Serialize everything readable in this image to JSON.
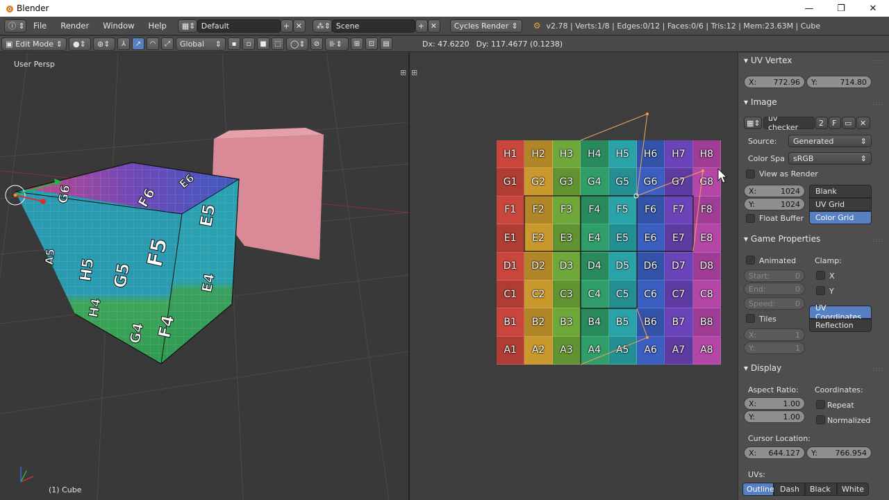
{
  "titlebar": {
    "title": "Blender",
    "minimize": "—",
    "maximize": "❐",
    "close": "✕"
  },
  "info": {
    "menus": [
      "File",
      "Render",
      "Window",
      "Help"
    ],
    "layout": "Default",
    "scene": "Scene",
    "engine": "Cycles Render",
    "stats": "v2.78 | Verts:1/8 | Edges:0/12 | Faces:0/6 | Tris:12 | Mem:23.63M | Cube"
  },
  "toolbar3d": {
    "mode": "Edit Mode",
    "orientation": "Global"
  },
  "uv_header": {
    "dx": "Dx: 47.6220",
    "dy": "Dy: 117.4677 (0.1238)"
  },
  "viewport": {
    "persp_label": "User Persp",
    "object_label": "(1) Cube"
  },
  "uv_grid": {
    "rows": [
      "H",
      "G",
      "F",
      "E",
      "D",
      "C",
      "B",
      "A"
    ],
    "cols": [
      "1",
      "2",
      "3",
      "4",
      "5",
      "6",
      "7",
      "8"
    ],
    "colors": [
      "#c8463c",
      "#c9992e",
      "#6fa83a",
      "#2f9e6a",
      "#2aa3a8",
      "#3b5fc0",
      "#6a44b8",
      "#b446a8"
    ]
  },
  "npanel": {
    "uv_vertex": {
      "title": "UV Vertex",
      "x_label": "X:",
      "x": "772.96",
      "y_label": "Y:",
      "y": "714.80"
    },
    "image": {
      "title": "Image",
      "name": "uv checker",
      "users": "2",
      "fake": "F",
      "source_label": "Source:",
      "source": "Generated",
      "colorspace_label": "Color Spa",
      "colorspace": "sRGB",
      "view_as_render": "View as Render",
      "width_label": "X:",
      "width": "1024",
      "height_label": "Y:",
      "height": "1024",
      "float_buffer": "Float Buffer",
      "types": [
        "Blank",
        "UV Grid",
        "Color Grid"
      ],
      "selected_type": "Color Grid"
    },
    "game": {
      "title": "Game Properties",
      "animated": "Animated",
      "clamp": "Clamp:",
      "clamp_x": "X",
      "clamp_y": "Y",
      "start_label": "Start:",
      "start": "0",
      "end_label": "End:",
      "end": "0",
      "speed_label": "Speed:",
      "speed": "0",
      "tiles": "Tiles",
      "tx_label": "X:",
      "tx": "1",
      "ty_label": "Y:",
      "ty": "1",
      "mapping": [
        "UV Coordinates",
        "Reflection"
      ],
      "selected_mapping": "UV Coordinates"
    },
    "display": {
      "title": "Display",
      "aspect": "Aspect Ratio:",
      "coords": "Coordinates:",
      "ax_label": "X:",
      "ax": "1.00",
      "ay_label": "Y:",
      "ay": "1.00",
      "repeat": "Repeat",
      "normalized": "Normalized",
      "cursor": "Cursor Location:",
      "cx_label": "X:",
      "cx": "644.127",
      "cy_label": "Y:",
      "cy": "766.954",
      "uvs": "UVs:",
      "uv_styles": [
        "Outline",
        "Dash",
        "Black",
        "White"
      ],
      "selected_uv_style": "Outline"
    }
  }
}
